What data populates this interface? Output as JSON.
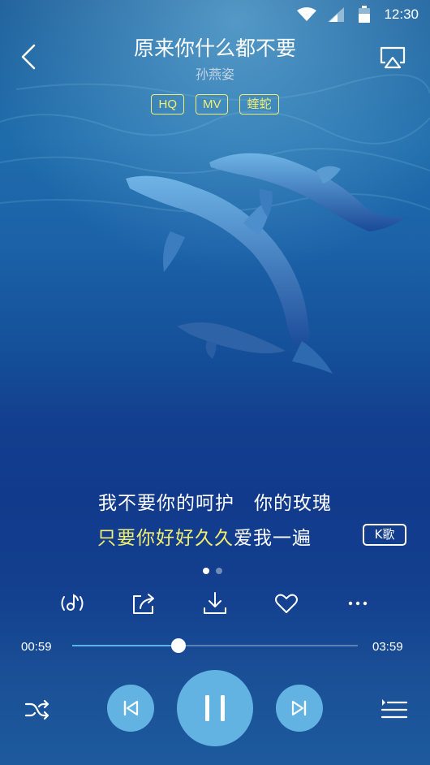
{
  "status_bar": {
    "time": "12:30"
  },
  "header": {
    "title": "原来你什么都不要",
    "artist": "孙燕姿",
    "tags": [
      "HQ",
      "MV",
      "蝰蛇"
    ]
  },
  "lyrics": {
    "line1": "我不要你的呵护　你的玫瑰",
    "line2_sung": "只要你好好久久",
    "line2_rest": "爱我一遍",
    "karaoke_label": "K歌"
  },
  "page_indicator": {
    "count": 2,
    "active": 0
  },
  "actions": [
    "sound-effect-icon",
    "share-icon",
    "download-icon",
    "heart-icon",
    "more-icon"
  ],
  "progress": {
    "elapsed": "00:59",
    "duration": "03:59",
    "fraction": 0.372
  },
  "controls": [
    "shuffle-icon",
    "previous-icon",
    "pause-icon",
    "next-icon",
    "playlist-icon"
  ],
  "colors": {
    "accent": "#62b3e2",
    "highlight": "#f2ee6e",
    "background": "#133f8f"
  }
}
